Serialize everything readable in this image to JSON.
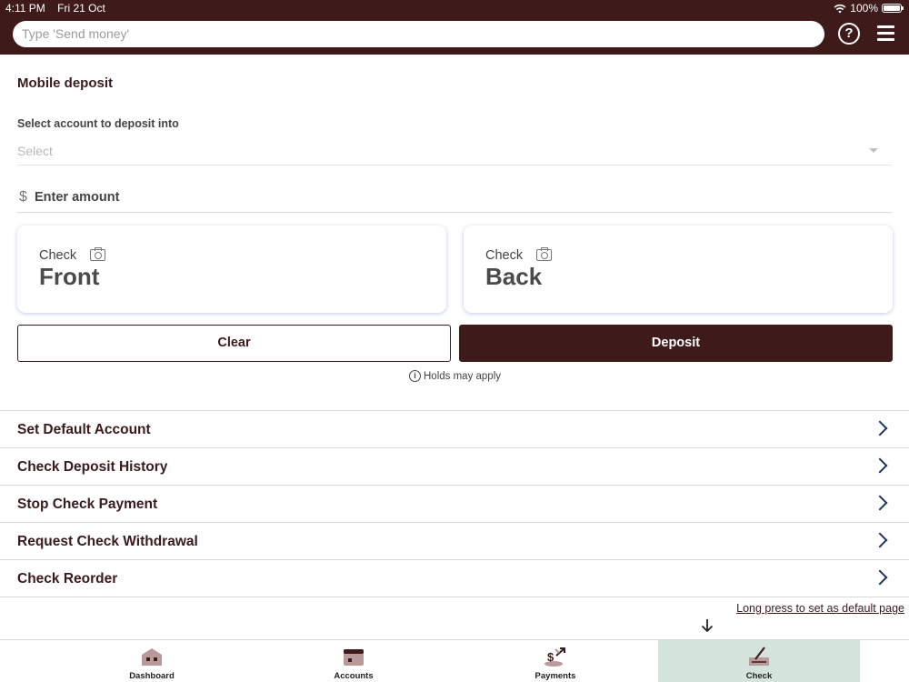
{
  "status_bar": {
    "time": "4:11 PM",
    "date": "Fri 21 Oct",
    "battery": "100%"
  },
  "header": {
    "search_placeholder": "Type 'Send money'",
    "help_icon": "question-circle-icon",
    "menu_icon": "hamburger-menu-icon"
  },
  "deposit": {
    "title": "Mobile deposit",
    "account_label": "Select account to deposit into",
    "account_value": "Select",
    "currency_symbol": "$",
    "amount_placeholder": "Enter amount",
    "front_label": "Check",
    "front_value": "Front",
    "back_label": "Check",
    "back_value": "Back",
    "clear_label": "Clear",
    "deposit_label": "Deposit",
    "holds_note": "Holds may apply"
  },
  "menu_list": [
    {
      "label": "Set Default Account"
    },
    {
      "label": "Check Deposit History"
    },
    {
      "label": "Stop Check Payment"
    },
    {
      "label": "Request Check Withdrawal"
    },
    {
      "label": "Check Reorder"
    }
  ],
  "long_press_hint": "Long press to set as default page",
  "bottom_nav": [
    {
      "label": "Dashboard",
      "icon": "dashboard-icon",
      "active": false
    },
    {
      "label": "Accounts",
      "icon": "wallet-icon",
      "active": false
    },
    {
      "label": "Payments",
      "icon": "payments-icon",
      "active": false
    },
    {
      "label": "Check",
      "icon": "check-icon",
      "active": true
    }
  ],
  "colors": {
    "brand": "#3e1a1a",
    "active_tab": "#d4e4dc",
    "chevron": "#1f3564"
  }
}
